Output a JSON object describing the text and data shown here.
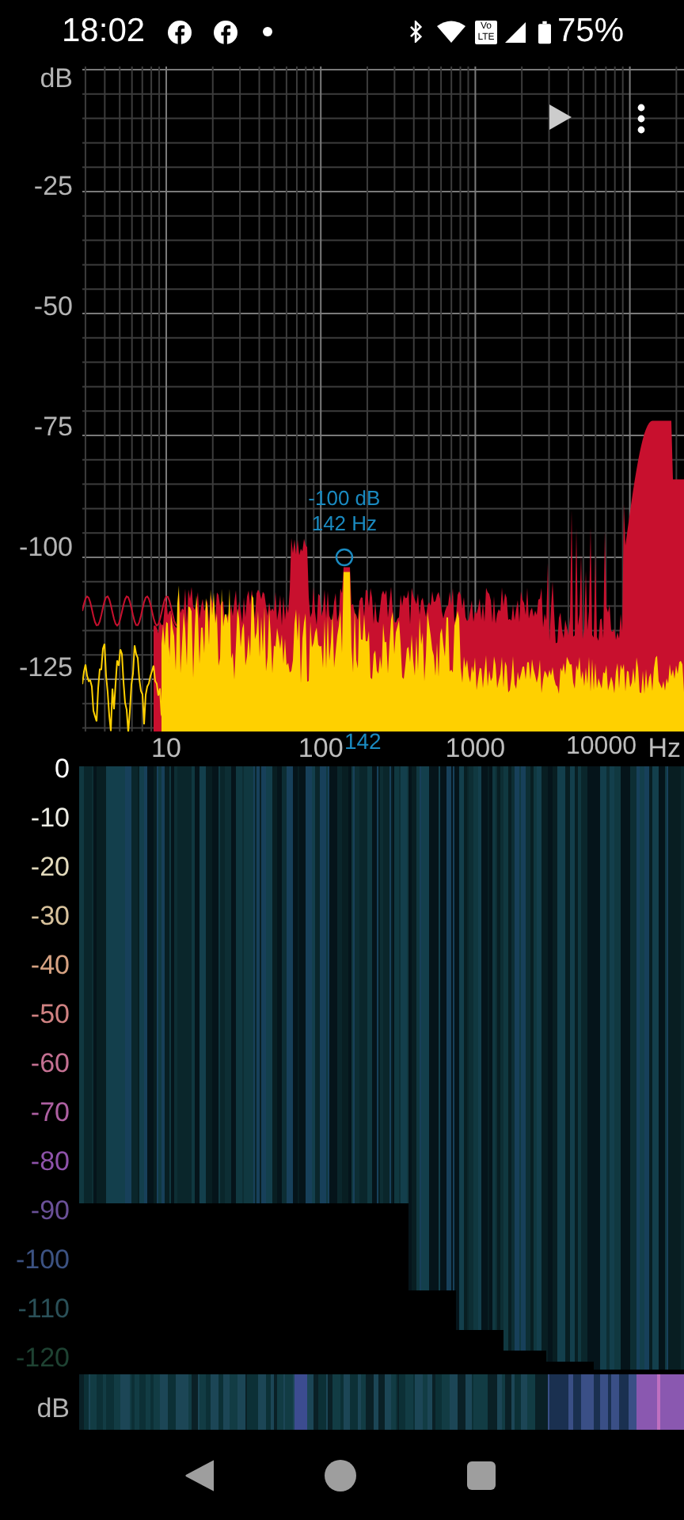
{
  "status_bar": {
    "time": "18:02",
    "volte": "Vo LTE",
    "battery": "75%"
  },
  "spectrum": {
    "y_labels": [
      "dB",
      "-25",
      "-50",
      "-75",
      "-100",
      "-125"
    ],
    "x_labels": [
      "10",
      "100",
      "1000",
      "10000"
    ],
    "x_unit": "Hz",
    "marker": {
      "level_text": "-100 dB",
      "freq_text": "142 Hz",
      "axis_text": "142"
    }
  },
  "spectrogram": {
    "y_labels": [
      {
        "text": "0",
        "color": "#ffffff"
      },
      {
        "text": "-10",
        "color": "#ecece4"
      },
      {
        "text": "-20",
        "color": "#e2dabc"
      },
      {
        "text": "-30",
        "color": "#d8c29c"
      },
      {
        "text": "-40",
        "color": "#d6a282"
      },
      {
        "text": "-50",
        "color": "#d08282"
      },
      {
        "text": "-60",
        "color": "#c47092"
      },
      {
        "text": "-70",
        "color": "#ae60a2"
      },
      {
        "text": "-80",
        "color": "#8e52aa"
      },
      {
        "text": "-90",
        "color": "#6a5098"
      },
      {
        "text": "-100",
        "color": "#3c5282"
      },
      {
        "text": "-110",
        "color": "#2a5058"
      },
      {
        "text": "-120",
        "color": "#1e4232"
      }
    ],
    "unit": "dB"
  }
}
